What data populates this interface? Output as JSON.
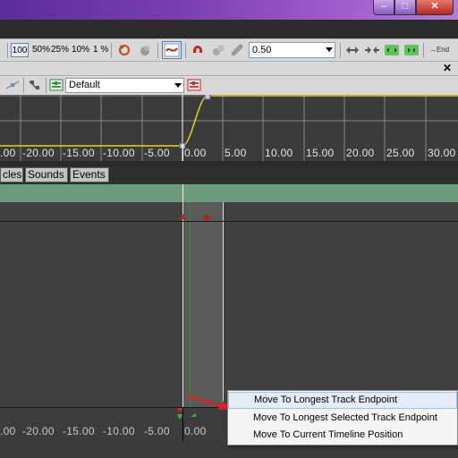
{
  "titlebar": {
    "minimize_glyph": "–",
    "maximize_glyph": "□",
    "close_glyph": "✕"
  },
  "toolbar": {
    "zoom_buttons": [
      "100",
      "50%",
      "25%",
      "10%",
      "1 %"
    ],
    "speed_value": "0.50",
    "end_label": "→End"
  },
  "panel": {
    "close_glyph": "✕"
  },
  "toolbar2": {
    "preset_value": "Default"
  },
  "ruler": {
    "labels": [
      ".00",
      "-20.00",
      "-15.00",
      "-10.00",
      "-5.00",
      "0.00",
      "5.00",
      "10.00",
      "15.00",
      "20.00",
      "25.00",
      "30.00"
    ]
  },
  "tabs": [
    "cles",
    "Sounds",
    "Events"
  ],
  "context_menu": {
    "items": [
      "Move To Longest Track Endpoint",
      "Move To Longest Selected Track Endpoint",
      "Move To Current Timeline Position"
    ]
  },
  "colors": {
    "curve": "#e6d21a",
    "playhead": "#ffffff",
    "track_green": "#6d9c7d",
    "marker_red": "#b52020",
    "annotation_arrow": "#e02020"
  }
}
